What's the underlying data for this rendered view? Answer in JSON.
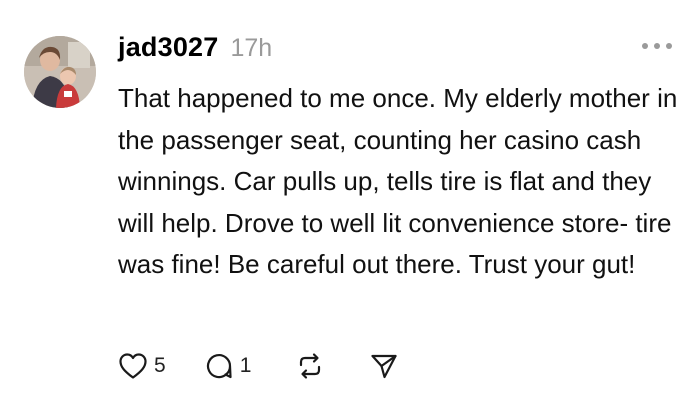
{
  "post": {
    "username": "jad3027",
    "timestamp": "17h",
    "text": "That happened to me once. My elderly mother in the passenger seat, counting her casino cash winnings. Car pulls up, tells tire is flat and they will help. Drove to well lit convenience store- tire was fine! Be careful out there. Trust your gut!"
  },
  "actions": {
    "like_icon": "heart-icon",
    "like_count": "5",
    "reply_icon": "comment-icon",
    "reply_count": "1",
    "repost_icon": "repost-icon",
    "share_icon": "send-icon"
  },
  "colors": {
    "timestamp": "#9a9a9a",
    "text": "#111111",
    "background": "#ffffff"
  }
}
